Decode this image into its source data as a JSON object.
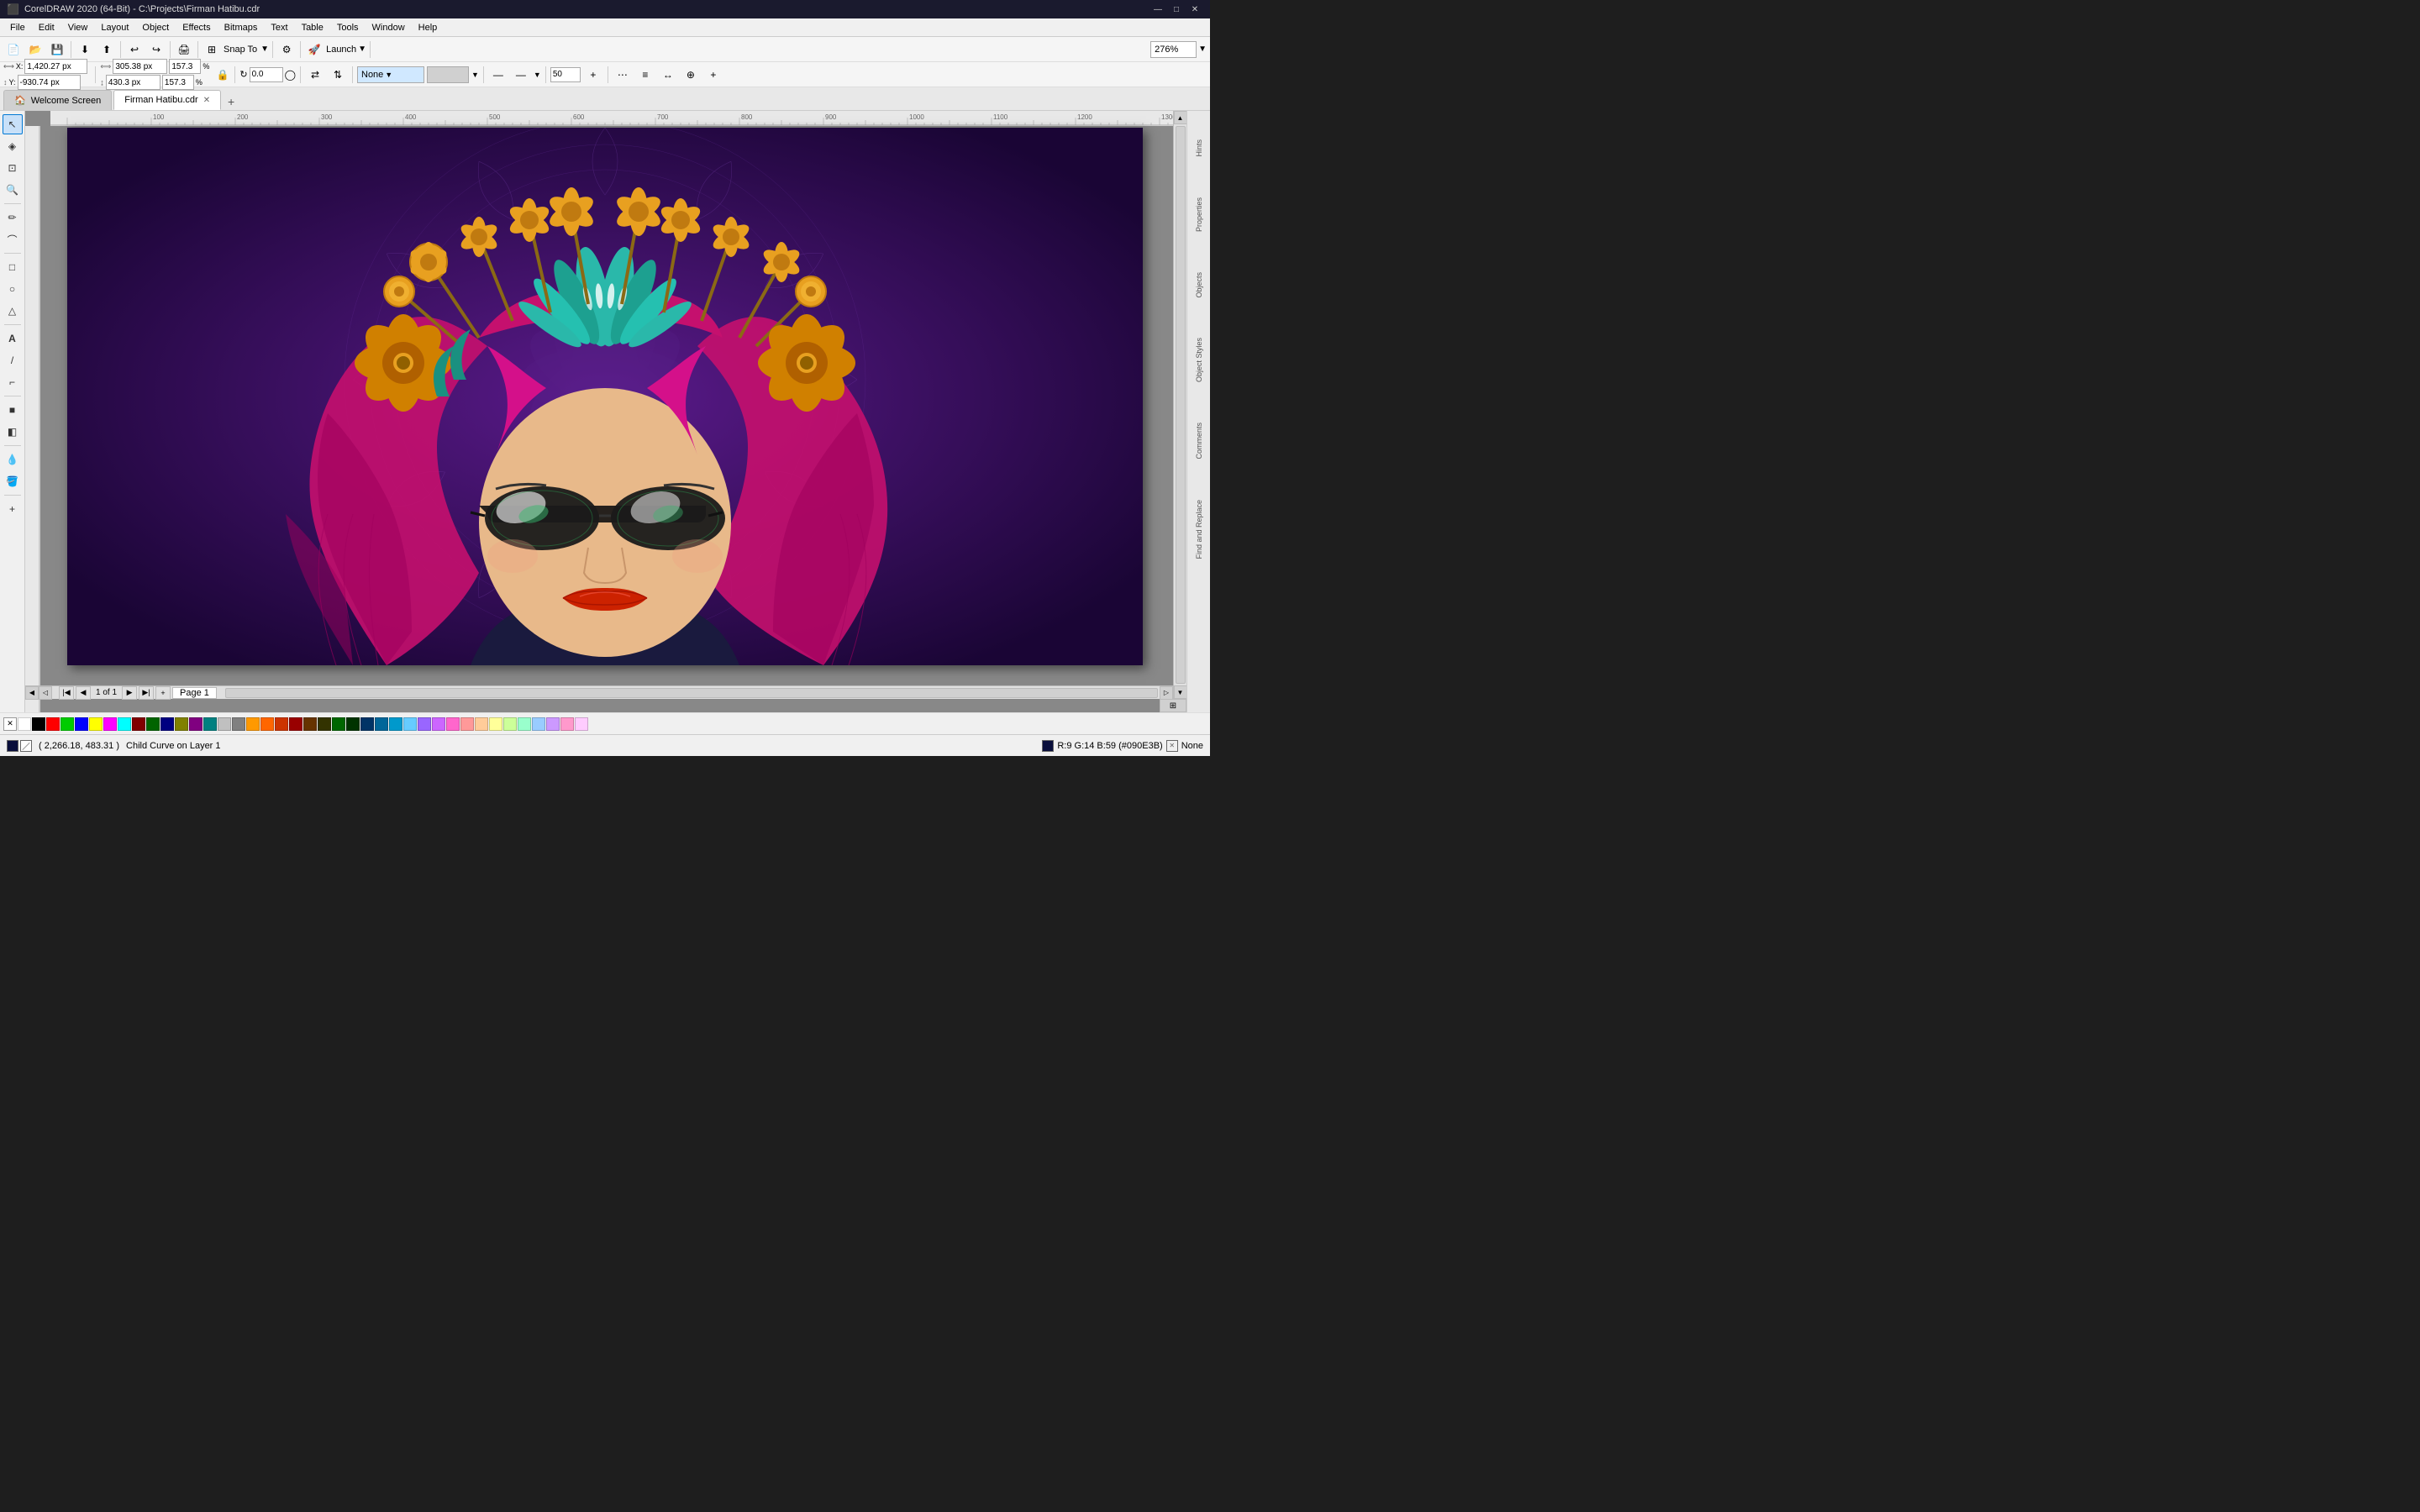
{
  "app": {
    "title": "CorelDRAW 2020 (64-Bit) - C:\\Projects\\Firman Hatibu.cdr",
    "icon": "⬛"
  },
  "titlebar": {
    "minimize": "—",
    "maximize": "□",
    "close": "✕"
  },
  "menu": {
    "items": [
      "File",
      "Edit",
      "View",
      "Layout",
      "Object",
      "Effects",
      "Bitmaps",
      "Text",
      "Table",
      "Tools",
      "Window",
      "Help"
    ]
  },
  "toolbar1": {
    "new_label": "New",
    "open_label": "Open",
    "save_label": "Save",
    "zoom_value": "276%"
  },
  "toolbar2": {
    "x_label": "X:",
    "x_value": "1,420.27 px",
    "y_label": "Y:",
    "y_value": "-930.74 px",
    "w_label": "W:",
    "w_value": "305.38 px",
    "w_pct": "157.3",
    "h_label": "H:",
    "h_value": "430.3 px",
    "h_pct": "157.3",
    "angle_value": "0.0",
    "fill_label": "None",
    "outline_value": "50"
  },
  "tabs": {
    "items": [
      {
        "label": "Welcome Screen",
        "active": false
      },
      {
        "label": "Firman Hatibu.cdr",
        "active": true
      }
    ],
    "add_label": "+"
  },
  "left_toolbar": {
    "tools": [
      {
        "name": "pointer",
        "icon": "↖",
        "active": true
      },
      {
        "name": "node-edit",
        "icon": "◈"
      },
      {
        "name": "crop",
        "icon": "⊡"
      },
      {
        "name": "zoom",
        "icon": "🔍"
      },
      {
        "name": "freehand",
        "icon": "✏"
      },
      {
        "name": "smart-draw",
        "icon": "⌒"
      },
      {
        "name": "rectangle",
        "icon": "□"
      },
      {
        "name": "ellipse",
        "icon": "○"
      },
      {
        "name": "polygon",
        "icon": "△"
      },
      {
        "name": "text",
        "icon": "A"
      },
      {
        "name": "parallel-dim",
        "icon": "/"
      },
      {
        "name": "connector",
        "icon": "⌐"
      },
      {
        "name": "drop-shadow",
        "icon": "■"
      },
      {
        "name": "transparency",
        "icon": "◧"
      },
      {
        "name": "eyedropper",
        "icon": "💧"
      },
      {
        "name": "paint-bucket",
        "icon": "🪣"
      },
      {
        "name": "plus",
        "icon": "+"
      }
    ]
  },
  "right_panel": {
    "items": [
      {
        "name": "hints",
        "label": "Hints"
      },
      {
        "name": "properties",
        "label": "Properties"
      },
      {
        "name": "objects",
        "label": "Objects"
      },
      {
        "name": "object-styles",
        "label": "Object Styles"
      },
      {
        "name": "comments",
        "label": "Comments"
      },
      {
        "name": "find-replace",
        "label": "Find and Replace"
      }
    ]
  },
  "canvas": {
    "page_number": "1",
    "page_total": "1",
    "page_label": "Page 1"
  },
  "statusbar": {
    "coordinates": "( 2,266.18, 483.31 )",
    "layer_info": "Child Curve on Layer 1",
    "color_info": "R:9 G:14 B:59 (#090E3B)",
    "outline_none": "None",
    "fill_label": "Fill:"
  },
  "colors": [
    "#ffffff",
    "#000000",
    "#ff0000",
    "#00ff00",
    "#0000ff",
    "#ffff00",
    "#ff00ff",
    "#00ffff",
    "#800000",
    "#008000",
    "#000080",
    "#808000",
    "#800080",
    "#008080",
    "#c0c0c0",
    "#808080",
    "#ff9900",
    "#ff6600",
    "#cc3300",
    "#990000",
    "#663300",
    "#333300",
    "#006600",
    "#003300",
    "#003366",
    "#006699",
    "#0099cc",
    "#66ccff",
    "#9966ff",
    "#cc66ff",
    "#ff66cc",
    "#ff9999",
    "#ffcc99",
    "#ffff99",
    "#ccff99",
    "#99ffcc",
    "#99ccff",
    "#cc99ff",
    "#ff99cc",
    "#ffccff",
    "#e6e6e6",
    "#d4d4d4",
    "#a0a0a0",
    "#686868",
    "#404040",
    "#202020",
    "#f5f0e8",
    "#ffe4c4",
    "#deb887",
    "#d2691e",
    "#8b4513",
    "#a0522d",
    "#cd853f",
    "#f4a460",
    "#c3a882",
    "#faebd7"
  ]
}
